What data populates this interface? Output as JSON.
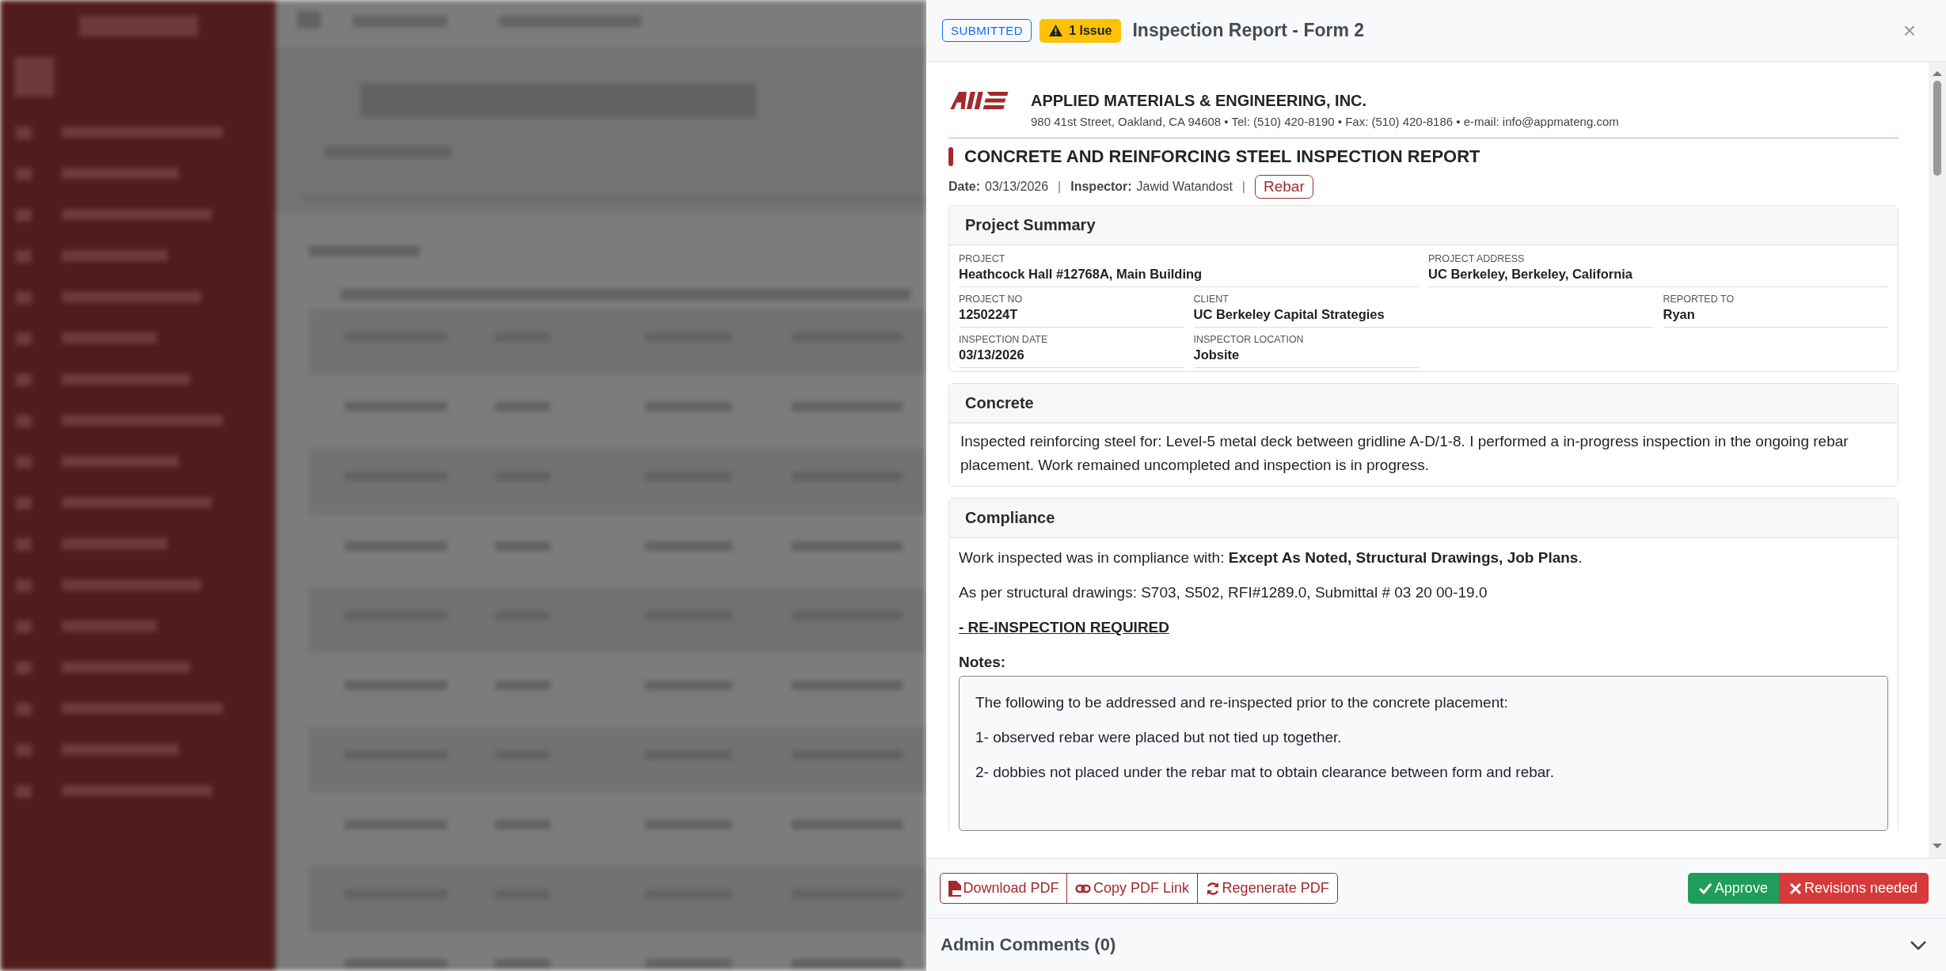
{
  "panel": {
    "status": "SUBMITTED",
    "issues": "1 Issue",
    "title": "Inspection Report - Form 2",
    "close": "×",
    "company": {
      "name": "APPLIED MATERIALS & ENGINEERING, INC.",
      "address": "980 41st Street, Oakland, CA 94608 • Tel: (510) 420-8190 • Fax: (510) 420-8186 • e-mail: info@appmateng.com"
    },
    "report_title": "CONCRETE AND REINFORCING STEEL INSPECTION REPORT",
    "meta": {
      "date_label": "Date:",
      "date": "03/13/2026",
      "inspector_label": "Inspector:",
      "inspector": "Jawid Watandost",
      "separator": "|",
      "tag": "Rebar"
    },
    "summary": {
      "title": "Project Summary",
      "fields": [
        {
          "label": "PROJECT",
          "value": "Heathcock Hall #12768A, Main Building"
        },
        {
          "label": "PROJECT ADDRESS",
          "value": "UC Berkeley, Berkeley, California"
        },
        {
          "label": "PROJECT NO",
          "value": "1250224T"
        },
        {
          "label": "CLIENT",
          "value": "UC Berkeley Capital Strategies"
        },
        {
          "label": "REPORTED TO",
          "value": "Ryan"
        },
        {
          "label": "INSPECTION DATE",
          "value": "03/13/2026"
        },
        {
          "label": "INSPECTOR LOCATION",
          "value": "Jobsite"
        }
      ]
    },
    "concrete": {
      "title": "Concrete",
      "text": "Inspected reinforcing steel for: Level-5 metal deck between gridline A-D/1-8. I performed a in-progress inspection in the ongoing rebar placement. Work remained uncompleted and inspection is in progress."
    },
    "compliance": {
      "title": "Compliance",
      "paragraphs": [
        "Work inspected was in compliance with: **Except As Noted, Structural Drawings, Job Plans**.",
        "As per structural drawings: S703, S502, RFI#1289.0, Submittal # 03 20 00-19.0"
      ],
      "reinspection": "- RE-INSPECTION REQUIRED",
      "notes_label": "Notes:",
      "notes": [
        "The following to be addressed and re-inspected prior to the concrete placement:",
        "1- observed rebar were placed but not tied up together.",
        "2- dobbies not placed under the rebar mat to obtain clearance between form and rebar."
      ]
    },
    "actions": [
      {
        "label": "Download PDF",
        "kind": "pdf"
      },
      {
        "label": "Copy PDF Link",
        "kind": "link"
      },
      {
        "label": "Regenerate PDF",
        "kind": "refresh"
      }
    ],
    "decisions": [
      {
        "label": "Approve",
        "kind": "approve"
      },
      {
        "label": "Revisions needed",
        "kind": "revise"
      }
    ],
    "admin_comments": "Admin Comments (0)"
  }
}
